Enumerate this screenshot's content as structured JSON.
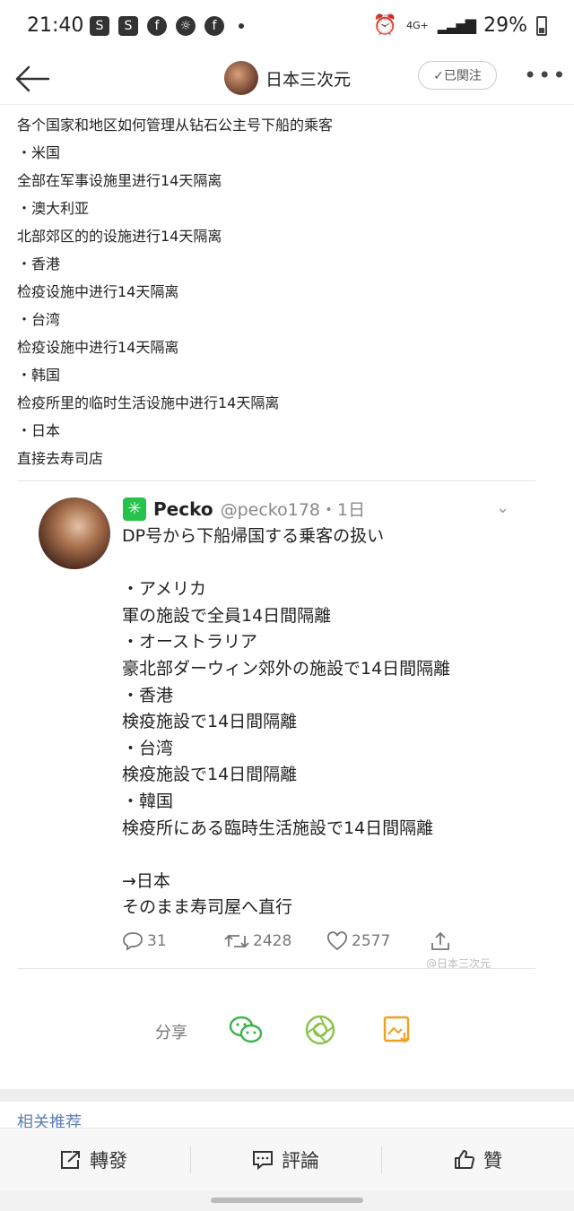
{
  "status_bar": {
    "time": "21:40",
    "battery": "29%",
    "network": "4G+"
  },
  "header": {
    "title": "日本三次元",
    "follow_label": "✓已関注"
  },
  "post_lines": [
    "各个国家和地区如何管理从钻石公主号下船的乘客",
    "・米国",
    "全部在军事设施里进行14天隔离",
    "・澳大利亚",
    "北部郊区的的设施进行14天隔离",
    "・香港",
    "检疫设施中进行14天隔离",
    "・台湾",
    "检疫设施中进行14天隔离",
    "・韩国",
    "检疫所里的临时生活设施中进行14天隔离",
    "・日本",
    "直接去寿司店"
  ],
  "tweet": {
    "name": "Pecko",
    "handle": "@pecko178・1日",
    "lines": [
      "DP号から下船帰国する乗客の扱い",
      "",
      "・アメリカ",
      "軍の施設で全員14日間隔離",
      "・オーストラリア",
      "豪北部ダーウィン郊外の施設で14日間隔離",
      "・香港",
      "検疫施設で14日間隔離",
      "・台湾",
      "検疫施設で14日間隔離",
      "・韓国",
      "検疫所にある臨時生活施設で14日間隔離",
      "",
      "→日本",
      "そのまま寿司屋へ直行"
    ],
    "replies": "31",
    "retweets": "2428",
    "likes": "2577",
    "watermark": "@日本三次元"
  },
  "share": {
    "label": "分享"
  },
  "related_label": "相关推荐",
  "bottom_bar": {
    "repost": "轉發",
    "comment": "評論",
    "like": "贊"
  }
}
